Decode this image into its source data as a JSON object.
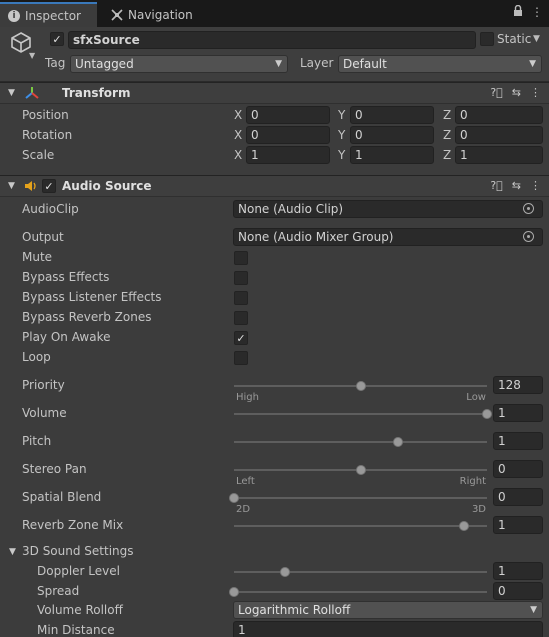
{
  "tabs": {
    "inspector": "Inspector",
    "navigation": "Navigation"
  },
  "header": {
    "object_name": "sfxSource",
    "static_label": "Static",
    "tag_label": "Tag",
    "tag_value": "Untagged",
    "layer_label": "Layer",
    "layer_value": "Default"
  },
  "transform": {
    "title": "Transform",
    "rows": [
      {
        "label": "Position",
        "x": "0",
        "y": "0",
        "z": "0"
      },
      {
        "label": "Rotation",
        "x": "0",
        "y": "0",
        "z": "0"
      },
      {
        "label": "Scale",
        "x": "1",
        "y": "1",
        "z": "1"
      }
    ],
    "axis_x": "X",
    "axis_y": "Y",
    "axis_z": "Z"
  },
  "audio": {
    "title": "Audio Source",
    "audioclip_label": "AudioClip",
    "audioclip_value": "None (Audio Clip)",
    "output_label": "Output",
    "output_value": "None (Audio Mixer Group)",
    "toggles": [
      {
        "label": "Mute",
        "checked": false
      },
      {
        "label": "Bypass Effects",
        "checked": false
      },
      {
        "label": "Bypass Listener Effects",
        "checked": false
      },
      {
        "label": "Bypass Reverb Zones",
        "checked": false
      },
      {
        "label": "Play On Awake",
        "checked": true
      },
      {
        "label": "Loop",
        "checked": false
      }
    ],
    "priority": {
      "label": "Priority",
      "value": "128",
      "fraction": 0.5,
      "min_cap": "High",
      "max_cap": "Low"
    },
    "volume": {
      "label": "Volume",
      "value": "1",
      "fraction": 1.0
    },
    "pitch": {
      "label": "Pitch",
      "value": "1",
      "fraction": 0.65
    },
    "stereo_pan": {
      "label": "Stereo Pan",
      "value": "0",
      "fraction": 0.5,
      "min_cap": "Left",
      "max_cap": "Right"
    },
    "spatial_blend": {
      "label": "Spatial Blend",
      "value": "0",
      "fraction": 0.0,
      "min_cap": "2D",
      "max_cap": "3D"
    },
    "reverb_mix": {
      "label": "Reverb Zone Mix",
      "value": "1",
      "fraction": 0.91
    },
    "sound3d": {
      "title": "3D Sound Settings",
      "doppler": {
        "label": "Doppler Level",
        "value": "1",
        "fraction": 0.2
      },
      "spread": {
        "label": "Spread",
        "value": "0",
        "fraction": 0.0
      },
      "rolloff_label": "Volume Rolloff",
      "rolloff_value": "Logarithmic Rolloff",
      "min_distance_label": "Min Distance",
      "min_distance_value": "1"
    }
  }
}
